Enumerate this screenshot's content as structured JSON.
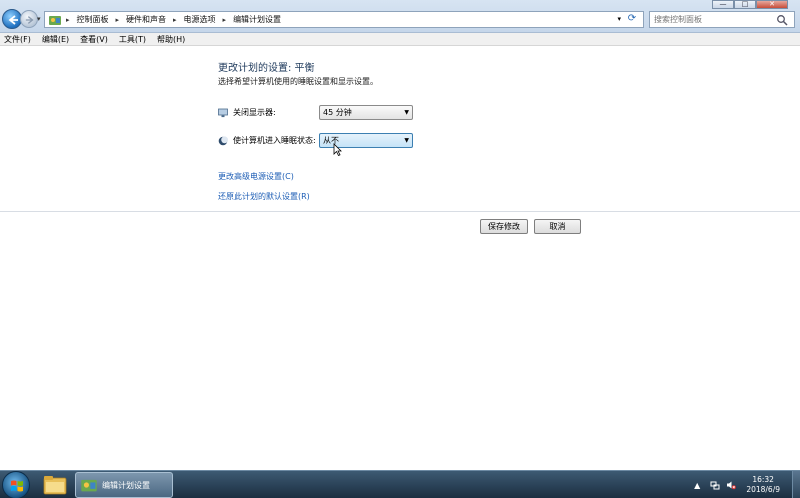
{
  "window": {
    "controls": {
      "minimize": "—",
      "maximize": "□",
      "close": "✕"
    }
  },
  "address": {
    "breadcrumbs": [
      "控制面板",
      "硬件和声音",
      "电源选项",
      "编辑计划设置"
    ],
    "icon": "control-panel-icon"
  },
  "search": {
    "placeholder": "搜索控制面板"
  },
  "menubar": {
    "items": [
      "文件(F)",
      "编辑(E)",
      "查看(V)",
      "工具(T)",
      "帮助(H)"
    ]
  },
  "main": {
    "title": "更改计划的设置: 平衡",
    "subtitle": "选择希望计算机使用的睡眠设置和显示设置。",
    "display_off": {
      "label": "关闭显示器:",
      "value": "45 分钟",
      "icon": "monitor-icon"
    },
    "sleep": {
      "label": "使计算机进入睡眠状态:",
      "value": "从不",
      "icon": "moon-icon"
    },
    "links": [
      "更改高级电源设置(C)",
      "还原此计划的默认设置(R)"
    ],
    "buttons": {
      "save": "保存修改",
      "cancel": "取消"
    }
  },
  "taskbar": {
    "active_task": "编辑计划设置",
    "clock": {
      "time": "16:32",
      "date": "2018/6/9"
    },
    "tray_arrow": "▲"
  },
  "colors": {
    "title": "#1e395b",
    "link": "#1c5db5",
    "taskbar": "#1b2e40"
  }
}
